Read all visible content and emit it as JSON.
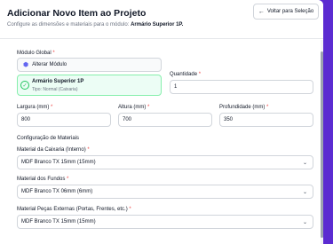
{
  "header": {
    "title": "Adicionar Novo Item ao Projeto",
    "subtitle_prefix": "Configure as dimensões e materiais para o módulo: ",
    "subtitle_module": "Armário Superior 1P.",
    "back_label": "Voltar para Seleção"
  },
  "module": {
    "label": "Módulo Global",
    "required": "*",
    "alter_label": "Alterar Módulo",
    "selected_name": "Armário Superior 1P",
    "selected_type": "Tipo: Normal (Caixaria)"
  },
  "quantity": {
    "label": "Quantidade",
    "required": "*",
    "value": "1"
  },
  "dimensions": {
    "width": {
      "label": "Largura (mm)",
      "required": "*",
      "value": "800"
    },
    "height": {
      "label": "Altura (mm)",
      "required": "*",
      "value": "700"
    },
    "depth": {
      "label": "Profundidade (mm)",
      "required": "*",
      "value": "350"
    }
  },
  "materials": {
    "section_title": "Configuração de Materiais",
    "carcass": {
      "label": "Material da Caixaria (Interno)",
      "required": "*",
      "value": "MDF Branco TX 15mm (15mm)"
    },
    "back": {
      "label": "Material dos Fundos",
      "required": "*",
      "value": "MDF Branco TX 06mm (6mm)"
    },
    "external": {
      "label": "Material Peças Externas (Portas, Frentes, etc.)",
      "required": "*",
      "value": "MDF Branco TX 15mm (15mm)"
    }
  },
  "icons": {
    "back": "arrow-left-icon",
    "cube": "cube-icon",
    "check": "check-circle-icon",
    "chevron": "chevron-down-icon"
  },
  "colors": {
    "background": "#5b2bd1",
    "accent": "#6366f1",
    "success": "#22c55e",
    "required": "#ef4444"
  }
}
